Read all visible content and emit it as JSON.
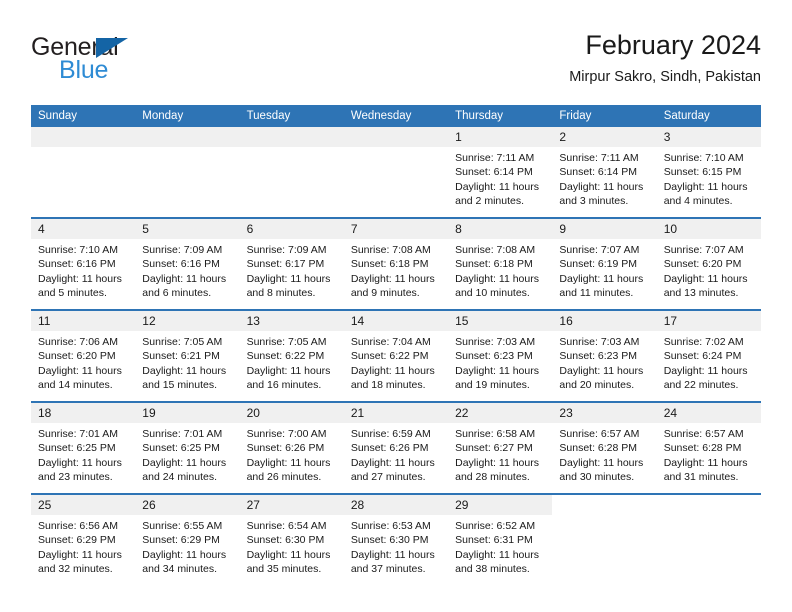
{
  "brand": {
    "name_top": "General",
    "name_bottom": "Blue",
    "triangle_color": "#1464a5",
    "blue_color": "#2e8bd4"
  },
  "header": {
    "title": "February 2024",
    "subtitle": "Mirpur Sakro, Sindh, Pakistan"
  },
  "theme": {
    "header_bg": "#2E74B5",
    "daynum_bg": "#F0F0F0",
    "row_divider": "#2E74B5"
  },
  "calendar": {
    "weekday_headers": [
      "Sunday",
      "Monday",
      "Tuesday",
      "Wednesday",
      "Thursday",
      "Friday",
      "Saturday"
    ],
    "labels": {
      "sunrise_prefix": "Sunrise:",
      "sunset_prefix": "Sunset:",
      "daylight_prefix": "Daylight:"
    },
    "weeks": [
      [
        {
          "day": "",
          "empty": true
        },
        {
          "day": "",
          "empty": true
        },
        {
          "day": "",
          "empty": true
        },
        {
          "day": "",
          "empty": true
        },
        {
          "day": "1",
          "sunrise": "Sunrise: 7:11 AM",
          "sunset": "Sunset: 6:14 PM",
          "daylight_line1": "Daylight: 11 hours",
          "daylight_line2": "and 2 minutes."
        },
        {
          "day": "2",
          "sunrise": "Sunrise: 7:11 AM",
          "sunset": "Sunset: 6:14 PM",
          "daylight_line1": "Daylight: 11 hours",
          "daylight_line2": "and 3 minutes."
        },
        {
          "day": "3",
          "sunrise": "Sunrise: 7:10 AM",
          "sunset": "Sunset: 6:15 PM",
          "daylight_line1": "Daylight: 11 hours",
          "daylight_line2": "and 4 minutes."
        }
      ],
      [
        {
          "day": "4",
          "sunrise": "Sunrise: 7:10 AM",
          "sunset": "Sunset: 6:16 PM",
          "daylight_line1": "Daylight: 11 hours",
          "daylight_line2": "and 5 minutes."
        },
        {
          "day": "5",
          "sunrise": "Sunrise: 7:09 AM",
          "sunset": "Sunset: 6:16 PM",
          "daylight_line1": "Daylight: 11 hours",
          "daylight_line2": "and 6 minutes."
        },
        {
          "day": "6",
          "sunrise": "Sunrise: 7:09 AM",
          "sunset": "Sunset: 6:17 PM",
          "daylight_line1": "Daylight: 11 hours",
          "daylight_line2": "and 8 minutes."
        },
        {
          "day": "7",
          "sunrise": "Sunrise: 7:08 AM",
          "sunset": "Sunset: 6:18 PM",
          "daylight_line1": "Daylight: 11 hours",
          "daylight_line2": "and 9 minutes."
        },
        {
          "day": "8",
          "sunrise": "Sunrise: 7:08 AM",
          "sunset": "Sunset: 6:18 PM",
          "daylight_line1": "Daylight: 11 hours",
          "daylight_line2": "and 10 minutes."
        },
        {
          "day": "9",
          "sunrise": "Sunrise: 7:07 AM",
          "sunset": "Sunset: 6:19 PM",
          "daylight_line1": "Daylight: 11 hours",
          "daylight_line2": "and 11 minutes."
        },
        {
          "day": "10",
          "sunrise": "Sunrise: 7:07 AM",
          "sunset": "Sunset: 6:20 PM",
          "daylight_line1": "Daylight: 11 hours",
          "daylight_line2": "and 13 minutes."
        }
      ],
      [
        {
          "day": "11",
          "sunrise": "Sunrise: 7:06 AM",
          "sunset": "Sunset: 6:20 PM",
          "daylight_line1": "Daylight: 11 hours",
          "daylight_line2": "and 14 minutes."
        },
        {
          "day": "12",
          "sunrise": "Sunrise: 7:05 AM",
          "sunset": "Sunset: 6:21 PM",
          "daylight_line1": "Daylight: 11 hours",
          "daylight_line2": "and 15 minutes."
        },
        {
          "day": "13",
          "sunrise": "Sunrise: 7:05 AM",
          "sunset": "Sunset: 6:22 PM",
          "daylight_line1": "Daylight: 11 hours",
          "daylight_line2": "and 16 minutes."
        },
        {
          "day": "14",
          "sunrise": "Sunrise: 7:04 AM",
          "sunset": "Sunset: 6:22 PM",
          "daylight_line1": "Daylight: 11 hours",
          "daylight_line2": "and 18 minutes."
        },
        {
          "day": "15",
          "sunrise": "Sunrise: 7:03 AM",
          "sunset": "Sunset: 6:23 PM",
          "daylight_line1": "Daylight: 11 hours",
          "daylight_line2": "and 19 minutes."
        },
        {
          "day": "16",
          "sunrise": "Sunrise: 7:03 AM",
          "sunset": "Sunset: 6:23 PM",
          "daylight_line1": "Daylight: 11 hours",
          "daylight_line2": "and 20 minutes."
        },
        {
          "day": "17",
          "sunrise": "Sunrise: 7:02 AM",
          "sunset": "Sunset: 6:24 PM",
          "daylight_line1": "Daylight: 11 hours",
          "daylight_line2": "and 22 minutes."
        }
      ],
      [
        {
          "day": "18",
          "sunrise": "Sunrise: 7:01 AM",
          "sunset": "Sunset: 6:25 PM",
          "daylight_line1": "Daylight: 11 hours",
          "daylight_line2": "and 23 minutes."
        },
        {
          "day": "19",
          "sunrise": "Sunrise: 7:01 AM",
          "sunset": "Sunset: 6:25 PM",
          "daylight_line1": "Daylight: 11 hours",
          "daylight_line2": "and 24 minutes."
        },
        {
          "day": "20",
          "sunrise": "Sunrise: 7:00 AM",
          "sunset": "Sunset: 6:26 PM",
          "daylight_line1": "Daylight: 11 hours",
          "daylight_line2": "and 26 minutes."
        },
        {
          "day": "21",
          "sunrise": "Sunrise: 6:59 AM",
          "sunset": "Sunset: 6:26 PM",
          "daylight_line1": "Daylight: 11 hours",
          "daylight_line2": "and 27 minutes."
        },
        {
          "day": "22",
          "sunrise": "Sunrise: 6:58 AM",
          "sunset": "Sunset: 6:27 PM",
          "daylight_line1": "Daylight: 11 hours",
          "daylight_line2": "and 28 minutes."
        },
        {
          "day": "23",
          "sunrise": "Sunrise: 6:57 AM",
          "sunset": "Sunset: 6:28 PM",
          "daylight_line1": "Daylight: 11 hours",
          "daylight_line2": "and 30 minutes."
        },
        {
          "day": "24",
          "sunrise": "Sunrise: 6:57 AM",
          "sunset": "Sunset: 6:28 PM",
          "daylight_line1": "Daylight: 11 hours",
          "daylight_line2": "and 31 minutes."
        }
      ],
      [
        {
          "day": "25",
          "sunrise": "Sunrise: 6:56 AM",
          "sunset": "Sunset: 6:29 PM",
          "daylight_line1": "Daylight: 11 hours",
          "daylight_line2": "and 32 minutes."
        },
        {
          "day": "26",
          "sunrise": "Sunrise: 6:55 AM",
          "sunset": "Sunset: 6:29 PM",
          "daylight_line1": "Daylight: 11 hours",
          "daylight_line2": "and 34 minutes."
        },
        {
          "day": "27",
          "sunrise": "Sunrise: 6:54 AM",
          "sunset": "Sunset: 6:30 PM",
          "daylight_line1": "Daylight: 11 hours",
          "daylight_line2": "and 35 minutes."
        },
        {
          "day": "28",
          "sunrise": "Sunrise: 6:53 AM",
          "sunset": "Sunset: 6:30 PM",
          "daylight_line1": "Daylight: 11 hours",
          "daylight_line2": "and 37 minutes."
        },
        {
          "day": "29",
          "sunrise": "Sunrise: 6:52 AM",
          "sunset": "Sunset: 6:31 PM",
          "daylight_line1": "Daylight: 11 hours",
          "daylight_line2": "and 38 minutes."
        },
        {
          "day": "",
          "empty": true,
          "blank": true
        },
        {
          "day": "",
          "empty": true,
          "blank": true
        }
      ]
    ]
  }
}
